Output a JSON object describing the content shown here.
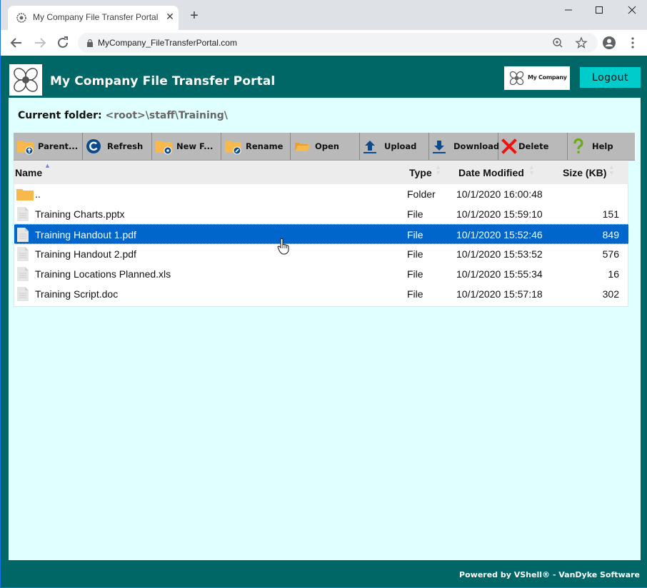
{
  "browser": {
    "tab_title": "My Company File Transfer Portal",
    "url": "MyCompany_FileTransferPortal.com"
  },
  "header": {
    "title": "My Company File Transfer Portal",
    "company_logo_text": "My Company",
    "logout_label": "Logout"
  },
  "current_folder": {
    "label": "Current folder:",
    "path": "<root>\\staff\\Training\\"
  },
  "toolbar": {
    "actions": [
      {
        "label": "Parent...",
        "icon": "folder-up-icon"
      },
      {
        "label": "Refresh",
        "icon": "refresh-icon"
      },
      {
        "label": "New F...",
        "icon": "new-folder-icon"
      },
      {
        "label": "Rename",
        "icon": "rename-folder-icon"
      },
      {
        "label": "Open",
        "icon": "open-folder-icon"
      },
      {
        "label": "Upload",
        "icon": "upload-icon"
      },
      {
        "label": "Download",
        "icon": "download-icon"
      },
      {
        "label": "Delete",
        "icon": "delete-icon"
      },
      {
        "label": "Help",
        "icon": "help-icon"
      }
    ]
  },
  "grid": {
    "columns": {
      "name": "Name",
      "type": "Type",
      "date": "Date Modified",
      "size": "Size (KB)"
    },
    "sorted_by": "name",
    "rows": [
      {
        "name": "..",
        "type": "Folder",
        "date": "10/1/2020 16:00:48",
        "size": "",
        "kind": "folder"
      },
      {
        "name": "Training Charts.pptx",
        "type": "File",
        "date": "10/1/2020 15:59:10",
        "size": "151",
        "kind": "file"
      },
      {
        "name": "Training Handout 1.pdf",
        "type": "File",
        "date": "10/1/2020 15:52:46",
        "size": "849",
        "kind": "file",
        "selected": true
      },
      {
        "name": "Training Handout 2.pdf",
        "type": "File",
        "date": "10/1/2020 15:53:52",
        "size": "576",
        "kind": "file"
      },
      {
        "name": "Training Locations Planned.xls",
        "type": "File",
        "date": "10/1/2020 15:55:34",
        "size": "16",
        "kind": "file"
      },
      {
        "name": "Training Script.doc",
        "type": "File",
        "date": "10/1/2020 15:57:18",
        "size": "302",
        "kind": "file"
      }
    ]
  },
  "footer": {
    "text": "Powered by VShell® - VanDyke Software"
  },
  "colors": {
    "header_bg": "#006666",
    "content_bg": "#e0ffff",
    "logout_bg": "#00cccc",
    "selected_row": "#0066cc",
    "toolbar_bg": "#b9b9b9"
  }
}
